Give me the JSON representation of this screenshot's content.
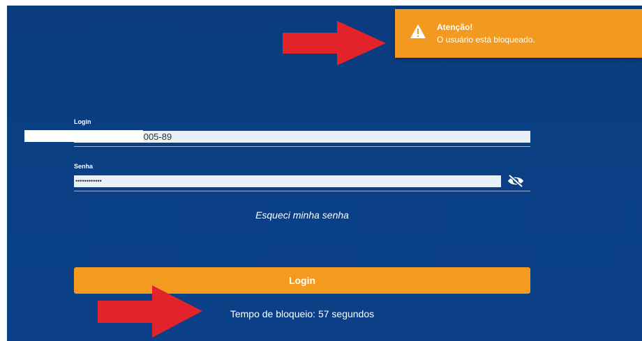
{
  "toast": {
    "title": "Atenção!",
    "message": "O usuário está bloqueado.",
    "color": "#f29a1f",
    "icon": "warning-icon"
  },
  "form": {
    "login_label": "Login",
    "login_value": "'0005-89",
    "password_label": "Senha",
    "password_value": "••••••••••••",
    "password_toggle_icon": "eye-off-icon",
    "forgot_label": "Esqueci minha senha",
    "submit_label": "Login",
    "lock_message": "Tempo de bloqueio: 57 segundos"
  },
  "colors": {
    "background": "#0a3f84",
    "accent": "#f39a1f",
    "input_bg": "#e9f1f8",
    "annotation_arrow": "#e3232a"
  }
}
